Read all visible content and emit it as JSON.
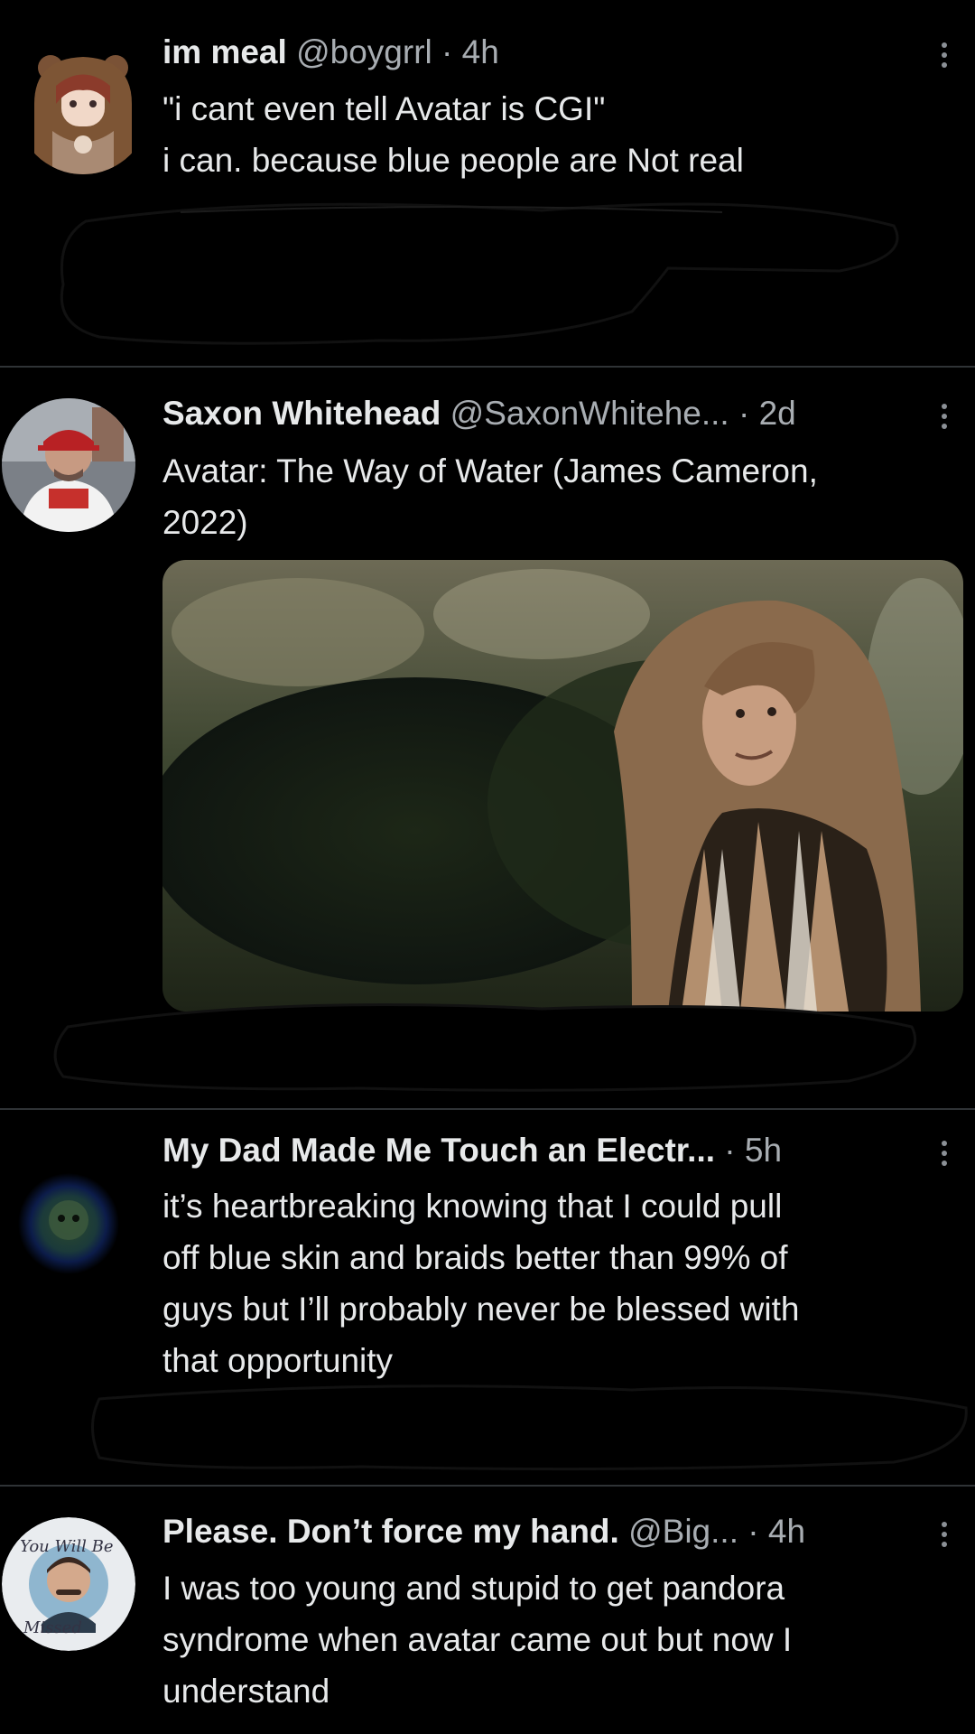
{
  "tweets": [
    {
      "name": "im meal",
      "handle": "@boygrrl",
      "dot": "·",
      "time": "4h",
      "lines": [
        "\"i cant even tell Avatar is CGI\"",
        "i can. because blue people are Not real"
      ]
    },
    {
      "name": "Saxon Whitehead",
      "handle": "@SaxonWhitehe...",
      "dot": "·",
      "time": "2d",
      "lines": [
        "Avatar: The Way of Water (James Cameron,",
        "2022)"
      ]
    },
    {
      "name": "My Dad Made Me Touch an Electr...",
      "handle": "",
      "dot": "·",
      "time": "5h",
      "lines": [
        "it’s heartbreaking knowing that I could pull",
        "off blue skin and braids better than 99% of",
        "guys but I’ll probably never be blessed with",
        "that opportunity"
      ]
    },
    {
      "name": "Please. Don’t force my hand.",
      "handle": "@Big...",
      "dot": "·",
      "time": "4h",
      "lines": [
        "I was too young and stupid to get pandora",
        "syndrome when avatar came out but now I",
        "understand"
      ]
    }
  ],
  "icons": {
    "more": "more-options-icon"
  },
  "colors": {
    "background": "#000000",
    "text": "#e7e9ea",
    "secondary": "#a8adb2",
    "divider": "#2f3336"
  }
}
